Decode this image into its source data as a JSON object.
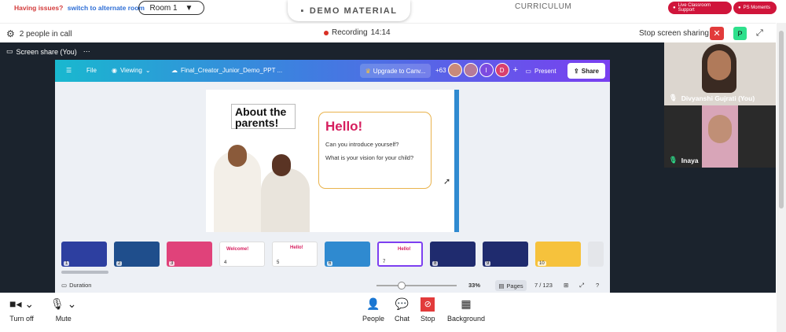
{
  "topbar": {
    "issues_text": "Having issues?",
    "switch_link": "switch to alternate room",
    "room_label": "Room 1",
    "demo_label": "DEMO MATERIAL",
    "curriculum_label": "CURRICULUM",
    "live_support": "Live Classroom Support",
    "ps_moments": "PS Moments"
  },
  "call": {
    "people": "2 people in call",
    "recording_label": "Recording",
    "recording_time": "14:14",
    "stop_sharing": "Stop screen sharing",
    "user_initial": "P",
    "screen_share_label": "Screen share (You)"
  },
  "canva": {
    "menu_file": "File",
    "menu_viewing": "Viewing",
    "doc_title": "Final_Creator_Junior_Demo_PPT ...",
    "upgrade": "Upgrade to Canv...",
    "collab_count": "+63",
    "avatar_i": "I",
    "avatar_d": "D",
    "present": "Present",
    "share": "Share",
    "slide": {
      "about_title": "About the parents!",
      "hello": "Hello!",
      "q1": "Can you introduce yourself?",
      "q2": "What is your vision for your child?"
    },
    "thumbnails": [
      {
        "n": "1",
        "color": "#2d3fa0",
        "label": ""
      },
      {
        "n": "2",
        "color": "#1f4e8c",
        "label": ""
      },
      {
        "n": "3",
        "color": "#e0427a",
        "label": ""
      },
      {
        "n": "4",
        "color": "#ffffff",
        "label": "Welcome!"
      },
      {
        "n": "5",
        "color": "#ffffff",
        "label": "Hello!"
      },
      {
        "n": "6",
        "color": "#2f8ad0",
        "label": ""
      },
      {
        "n": "7",
        "color": "#ffffff",
        "label": "Hello!"
      },
      {
        "n": "8",
        "color": "#1f2b6e",
        "label": ""
      },
      {
        "n": "9",
        "color": "#1f2b6e",
        "label": ""
      },
      {
        "n": "10",
        "color": "#f6c23c",
        "label": ""
      }
    ],
    "duration": "Duration",
    "zoom": "33%",
    "pages": "Pages",
    "page_count": "7 / 123"
  },
  "participants": [
    {
      "name": "Divyanshi Gujrati (You)"
    },
    {
      "name": "Inaya"
    }
  ],
  "controls": {
    "turn_off": "Turn off",
    "mute": "Mute",
    "people": "People",
    "chat": "Chat",
    "stop": "Stop",
    "background": "Background"
  }
}
